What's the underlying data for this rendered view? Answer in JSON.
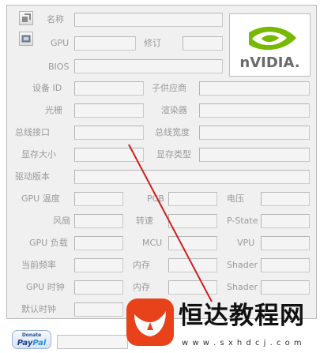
{
  "labels": {
    "name": "名称",
    "gpu": "GPU",
    "revision": "修订",
    "bios": "BIOS",
    "device_id": "设备 ID",
    "subvendor": "子供应商",
    "rops": "光栅",
    "shaders": "渲染器",
    "bus_interface": "总线接口",
    "bus_width": "总线宽度",
    "memory_size": "显存大小",
    "memory_type": "显存类型",
    "driver_version": "驱动版本",
    "gpu_temp": "GPU 温度",
    "pcb": "PCB",
    "voltage": "电压",
    "fan": "风扇",
    "speed": "转速",
    "pstate": "P-State",
    "gpu_load": "GPU 负载",
    "mcu": "MCU",
    "vpu": "VPU",
    "current_clock": "当前频率",
    "memory_1": "内存",
    "shader_1": "Shader",
    "gpu_clock": "GPU 时钟",
    "memory_2": "内存",
    "shader_2": "Shader",
    "default_clock": "默认时钟"
  },
  "logo": {
    "brand": "nVIDIA.",
    "accent": "#76b900"
  },
  "donate": {
    "top": "Donate",
    "pay": "Pay",
    "pal": "Pal"
  },
  "watermark": {
    "title": "恒达教程网",
    "url": "w w w . s x h d c j . c o m"
  },
  "icons": {
    "toolbar_top": "refresh-icon",
    "toolbar_bottom": "screenshot-icon"
  },
  "colors": {
    "annotation_line": "#d21e1e",
    "watermark_badge": "#e8421a"
  }
}
